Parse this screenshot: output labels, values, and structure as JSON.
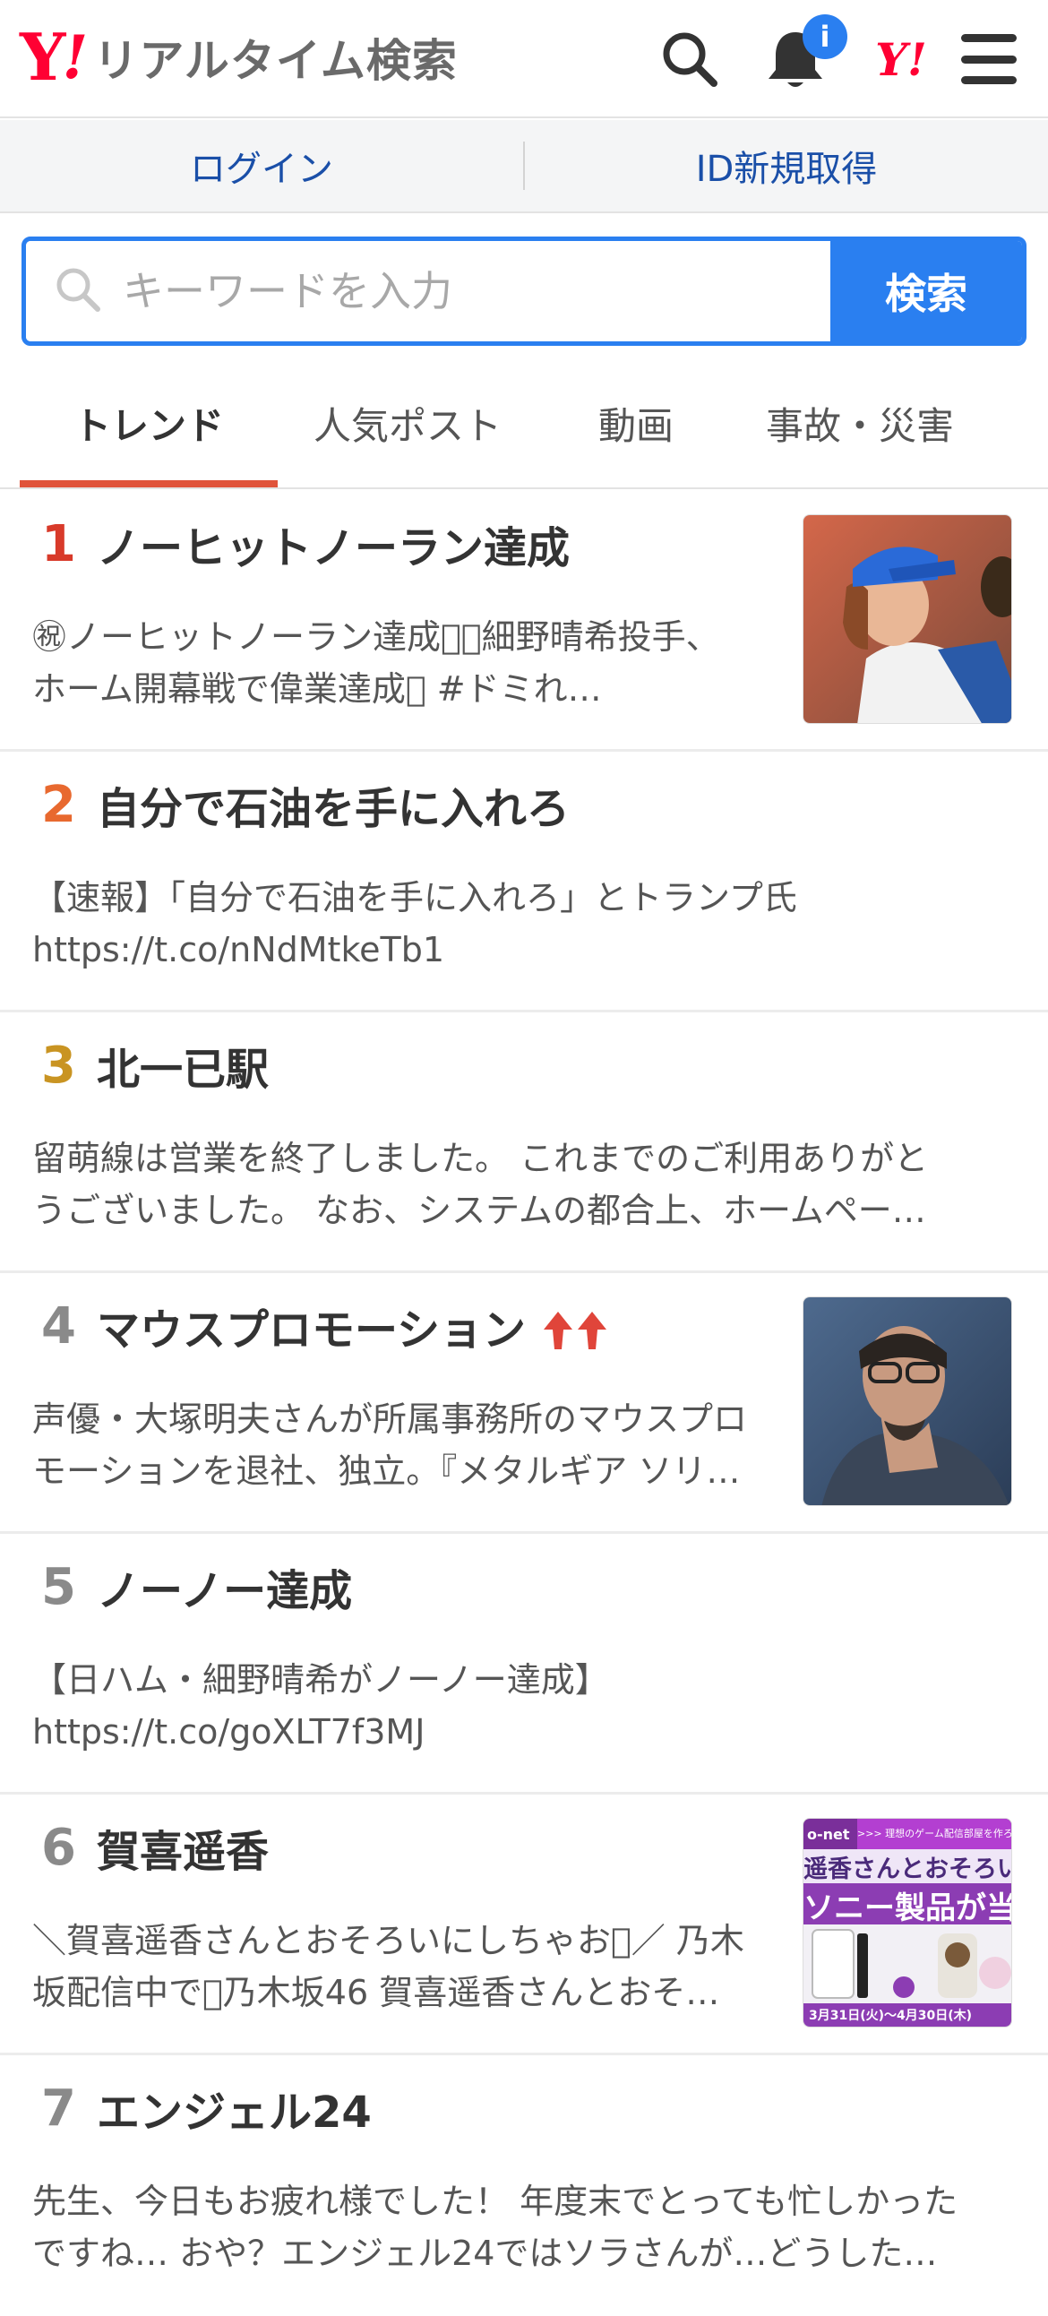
{
  "header": {
    "logo_y": "Y",
    "logo_bang": "!",
    "logo_text": "リアルタイム検索",
    "badge": "i",
    "yj_label": "Y!"
  },
  "login": {
    "login_label": "ログイン",
    "register_label": "ID新規取得"
  },
  "search": {
    "placeholder": "キーワードを入力",
    "button_label": "検索"
  },
  "tabs": [
    {
      "label": "トレンド",
      "active": true
    },
    {
      "label": "人気ポスト",
      "active": false
    },
    {
      "label": "動画",
      "active": false
    },
    {
      "label": "事故・災害",
      "active": false
    }
  ],
  "colors": {
    "accent_blue": "#2a7ff0",
    "brand_red": "#ff0033",
    "rank1": "#d83a2a",
    "rank2": "#e8692f",
    "rank3": "#c99422",
    "rank_other": "#8a8a8a",
    "tab_underline": "#e0533a",
    "trend_up_arrow": "#e0453a"
  },
  "trends": [
    {
      "rank": "1",
      "title": "ノーヒットノーラン達成",
      "desc": "㊗ノーヒットノーラン達成\u0000\u0000細野晴希投手、\nホーム開幕戦で偉業達成\u0000 #ドミれ…",
      "thumb": "baseball-pitcher-photo"
    },
    {
      "rank": "2",
      "title": "自分で石油を手に入れろ",
      "desc": "【速報】「自分で石油を手に入れろ」とトランプ氏\nhttps://t.co/nNdMtkeTb1"
    },
    {
      "rank": "3",
      "title": "北一已駅",
      "desc": "留萌線は営業を終了しました。 これまでのご利用ありがと\nうございました。 なお、システムの都合上、ホームペー…"
    },
    {
      "rank": "4",
      "title": "マウスプロモーション",
      "desc": "声優・大塚明夫さんが所属事務所のマウスプロ\nモーションを退社、独立。『メタルギア ソリ…",
      "thumb": "man-portrait-photo",
      "trending_up": true
    },
    {
      "rank": "5",
      "title": "ノーノー達成",
      "desc": "【日ハム・細野晴希がノーノー達成】\nhttps://t.co/goXLT7f3MJ"
    },
    {
      "rank": "6",
      "title": "賀喜遥香",
      "desc": "＼賀喜遥香さんとおそろいにしちゃお\u0000／ 乃木\n坂配信中で\u0000乃木坂46 賀喜遥香さんとおそ…",
      "thumb": "sony-promo-banner"
    },
    {
      "rank": "7",
      "title": "エンジェル24",
      "desc": "先生、今日もお疲れ様でした！ 年度末でとっても忙しかった\nですね… おや？エンジェル24ではソラさんが…どうした…"
    }
  ],
  "promo": {
    "brand": "o-net",
    "headline_top": "遥香さんとおそろいの",
    "headline_bottom": "ソニー製品が当",
    "tag": ">>> 理想のゲーム配信部屋を作ろ",
    "dates": "3月31日(火)～4月30日(木)"
  }
}
